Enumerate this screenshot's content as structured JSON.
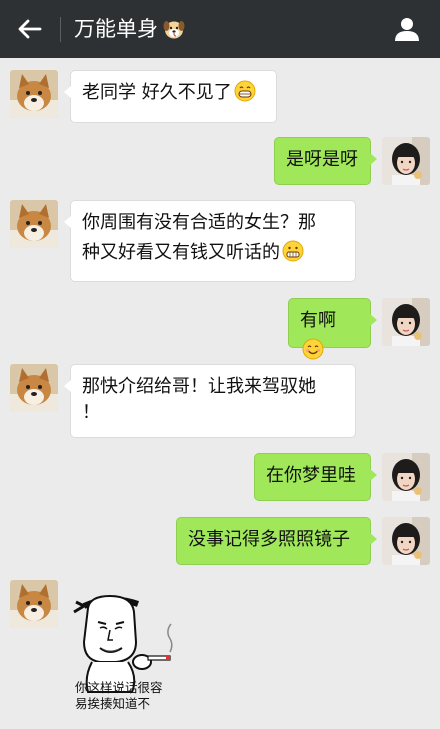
{
  "header": {
    "title": "万能单身",
    "title_icon": "dog-face-icon",
    "back_icon": "back-arrow-icon",
    "profile_icon": "person-icon",
    "bg_color": "#2e3133"
  },
  "messages": [
    {
      "side": "left",
      "text": "老同学 好久不见了",
      "emoji": "grin-emoji"
    },
    {
      "side": "right",
      "text": "是呀是呀"
    },
    {
      "side": "left",
      "line1": "你周围有没有合适的女生？那",
      "line2": "种又好看又有钱又听话的",
      "emoji": "grimace-emoji"
    },
    {
      "side": "right",
      "text": "有啊",
      "emoji": "smile-emoji"
    },
    {
      "side": "left",
      "line1": "那快介绍给哥！让我来驾驭她",
      "line2": "！"
    },
    {
      "side": "right",
      "text": "在你梦里哇"
    },
    {
      "side": "right",
      "text": "没事记得多照照镜子"
    },
    {
      "side": "left",
      "type": "sticker",
      "caption_line1": "你这样说话很容",
      "caption_line2": "易挨揍知道不"
    }
  ],
  "colors": {
    "bubble_right": "#a0e75a",
    "bubble_left": "#ffffff",
    "chat_bg": "#ebebeb"
  }
}
